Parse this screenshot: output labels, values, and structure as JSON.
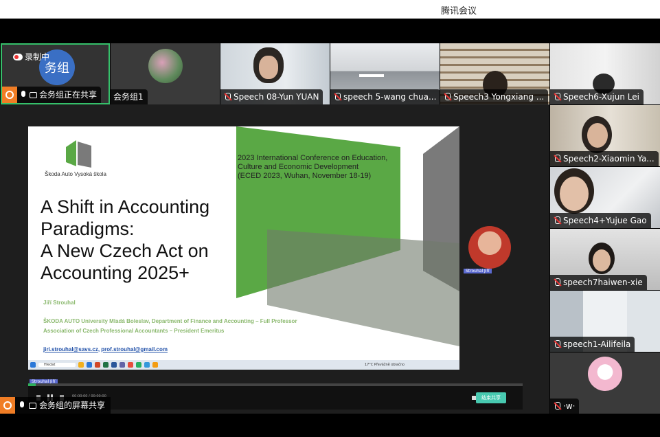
{
  "app": {
    "title": "腾讯会议"
  },
  "recording": {
    "label": "录制中"
  },
  "top_tiles": [
    {
      "name": "会务组正在共享",
      "avatar_text": "务组"
    },
    {
      "name": "会务组1"
    },
    {
      "name": "Speech 08-Yun YUAN"
    },
    {
      "name": "speech 5-wang chua..."
    },
    {
      "name": "Speech3 Yongxiang ..."
    },
    {
      "name": "Speech6-Xujun Lei"
    }
  ],
  "side_tiles": [
    {
      "name": "Speech2-Xiaomin Ya..."
    },
    {
      "name": "Speech4+Yujue Gao"
    },
    {
      "name": "speech7haiwen-xie"
    },
    {
      "name": "speech1-Ailifeila"
    },
    {
      "name": "·w·"
    }
  ],
  "slide": {
    "school": "Škoda Auto Vysoká škola",
    "conference": [
      "2023 International Conference on Education,",
      "Culture and Economic Development",
      "(ECED 2023, Wuhan, November 18-19)"
    ],
    "title_lines": [
      "A Shift in Accounting",
      "Paradigms:",
      "A New Czech Act on",
      "Accounting 2025+"
    ],
    "author": "Jiří Strouhal",
    "affiliation1": "ŠKODA AUTO University Mladá Boleslav, Department of Finance and Accounting – Full Professor",
    "affiliation2": "Association of Czech Professional Accountants – President Emeritus",
    "email1": "jiri.strouhal@savs.cz",
    "email_sep": ", ",
    "email2": "prof.strouhal@gmail.com",
    "presenter_tag": "Strouhal Jiří",
    "taskbar_search": "Hledat",
    "taskbar_weather": "17°C  Převážně oblačno"
  },
  "video_overlay_tag": "Strouhal Jiří",
  "share_button": "结束共享",
  "bottom_bar": {
    "label": "会务组的屏幕共享"
  },
  "playback": {
    "time": "00:00:00 / 00:00:00"
  }
}
